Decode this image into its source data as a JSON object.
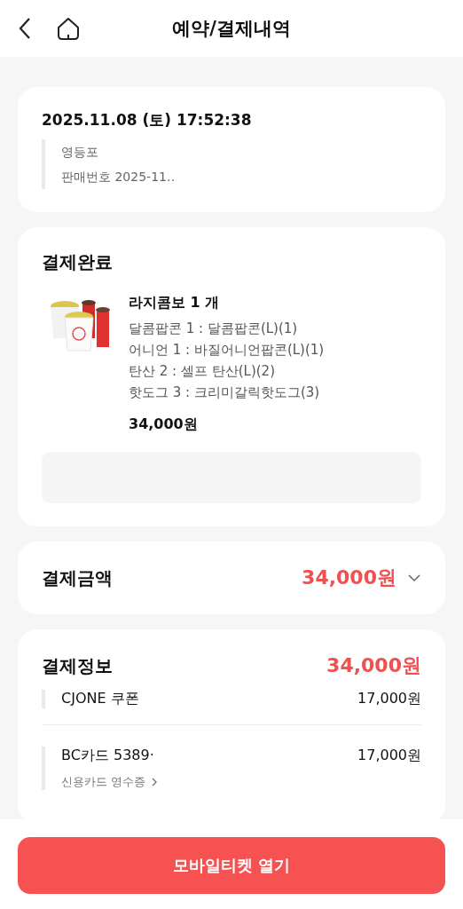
{
  "header": {
    "title": "예약/결제내역"
  },
  "order": {
    "datetime": "2025.11.08 (토) 17:52:38",
    "details": [
      "영등포",
      "판매번호 2025-11‥"
    ]
  },
  "completion": {
    "title": "결제완료",
    "item": {
      "kind": "picture",
      "name": "라지콤보 1 개",
      "options": [
        "달콤팝콘 1 : 달콤팝콘(L)(1)",
        "어니언 1 : 바질어니언팝콘(L)(1)",
        "탄산 2 : 셀프 탄산(L)(2)",
        "핫도그 3 : 크리미갈릭핫도그(3)"
      ],
      "price": "34,000원"
    }
  },
  "amount": {
    "label": "결제금액",
    "value": "34,000원",
    "expanded": false
  },
  "payment": {
    "title": "결제정보",
    "total": "34,000원",
    "methods": [
      {
        "name": "CJONE 쿠폰",
        "amount": "17,000원"
      },
      {
        "name": "BC카드 5389·",
        "amount": "17,000원",
        "receipt": "신용카드 영수증"
      }
    ]
  },
  "action": {
    "label": "모바일티켓 열기"
  }
}
